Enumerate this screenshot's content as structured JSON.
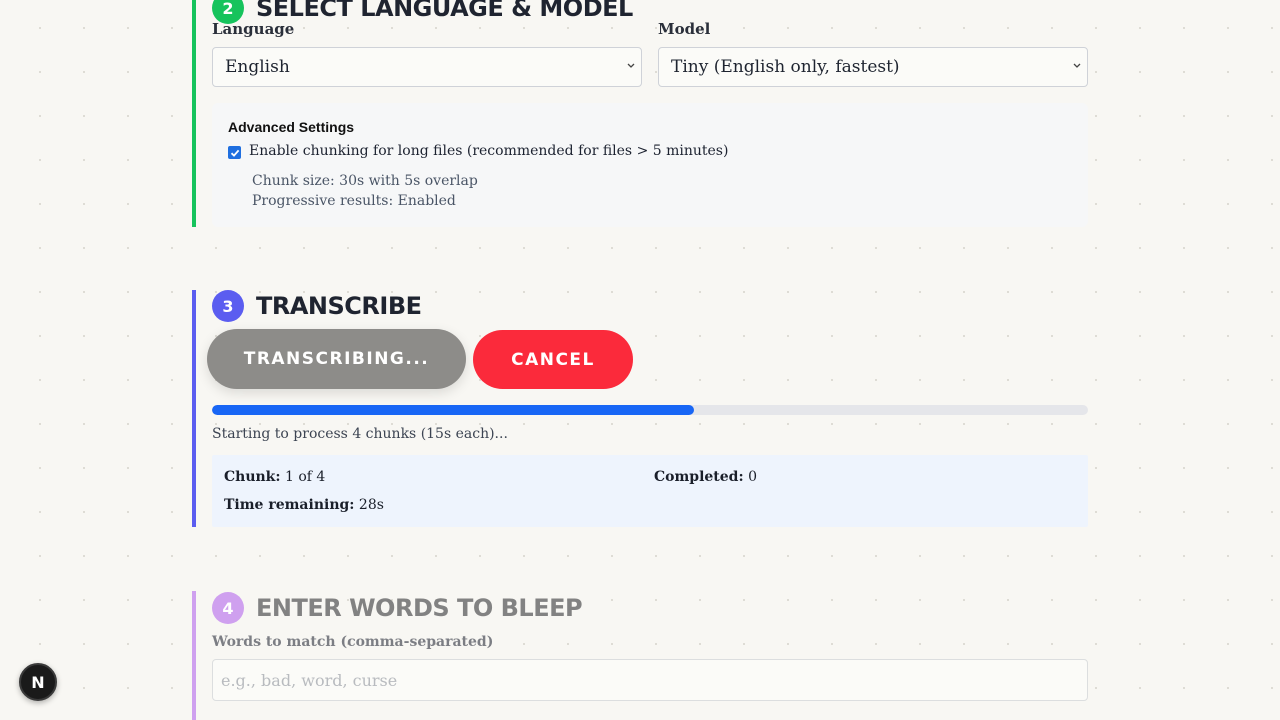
{
  "step2": {
    "number": "2",
    "title": "SELECT LANGUAGE & MODEL",
    "color": "#16c35c",
    "language_label": "Language",
    "language_value": "English",
    "model_label": "Model",
    "model_value": "Tiny (English only, fastest)",
    "advanced": {
      "title": "Advanced Settings",
      "chunking_label": "Enable chunking for long files (recommended for files > 5 minutes)",
      "chunking_checked": true,
      "chunk_size": "Chunk size: 30s with 5s overlap",
      "progressive": "Progressive results: Enabled"
    }
  },
  "step3": {
    "number": "3",
    "title": "TRANSCRIBE",
    "color": "#5b5df0",
    "transcribe_button": "TRANSCRIBING...",
    "cancel_button": "CANCEL",
    "progress": 0.55,
    "status_text": "Starting to process 4 chunks (15s each)...",
    "stats": {
      "chunk_label": "Chunk:",
      "chunk_value": "1 of 4",
      "completed_label": "Completed:",
      "completed_value": "0",
      "time_label": "Time remaining:",
      "time_value": "28s"
    }
  },
  "step4": {
    "number": "4",
    "title": "ENTER WORDS TO BLEEP",
    "color": "#cfa0ef",
    "words_label": "Words to match (comma-separated)",
    "words_placeholder": "e.g., bad, word, curse",
    "words_value": ""
  },
  "dev_badge": {
    "letter": "N",
    "icon": "nextjs-logo-icon"
  }
}
